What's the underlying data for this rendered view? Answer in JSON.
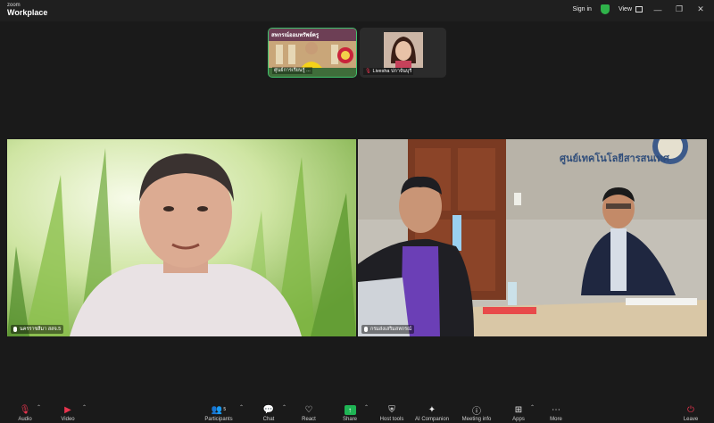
{
  "titlebar": {
    "brand_small": "zoom",
    "brand_big": "Workplace",
    "sign_in": "Sign in",
    "view": "View"
  },
  "thumbnails": [
    {
      "name": "ศูนย์การเรียนรู้ ...",
      "sign": "สหกรณ์ออมทรัพย์ครู"
    },
    {
      "name": "Livesha ปกาจันบุรี"
    }
  ],
  "videos": [
    {
      "name": "นครราชสีมา สสจ.5"
    },
    {
      "name": "กรมส่งเสริมสหกรณ์"
    }
  ],
  "room_sign": "ศูนย์เทคโนโลยีสารสนเทศ",
  "toolbar": {
    "audio": "Audio",
    "video": "Video",
    "participants": "Participants",
    "participants_count": "5",
    "chat": "Chat",
    "react": "React",
    "share": "Share",
    "host_tools": "Host tools",
    "ai_companion": "AI Companion",
    "meeting_info": "Meeting info",
    "apps": "Apps",
    "more": "More",
    "leave": "Leave"
  },
  "colors": {
    "accent_green": "#1fb454",
    "muted_red": "#e8344e",
    "background": "#1a1a1a"
  }
}
